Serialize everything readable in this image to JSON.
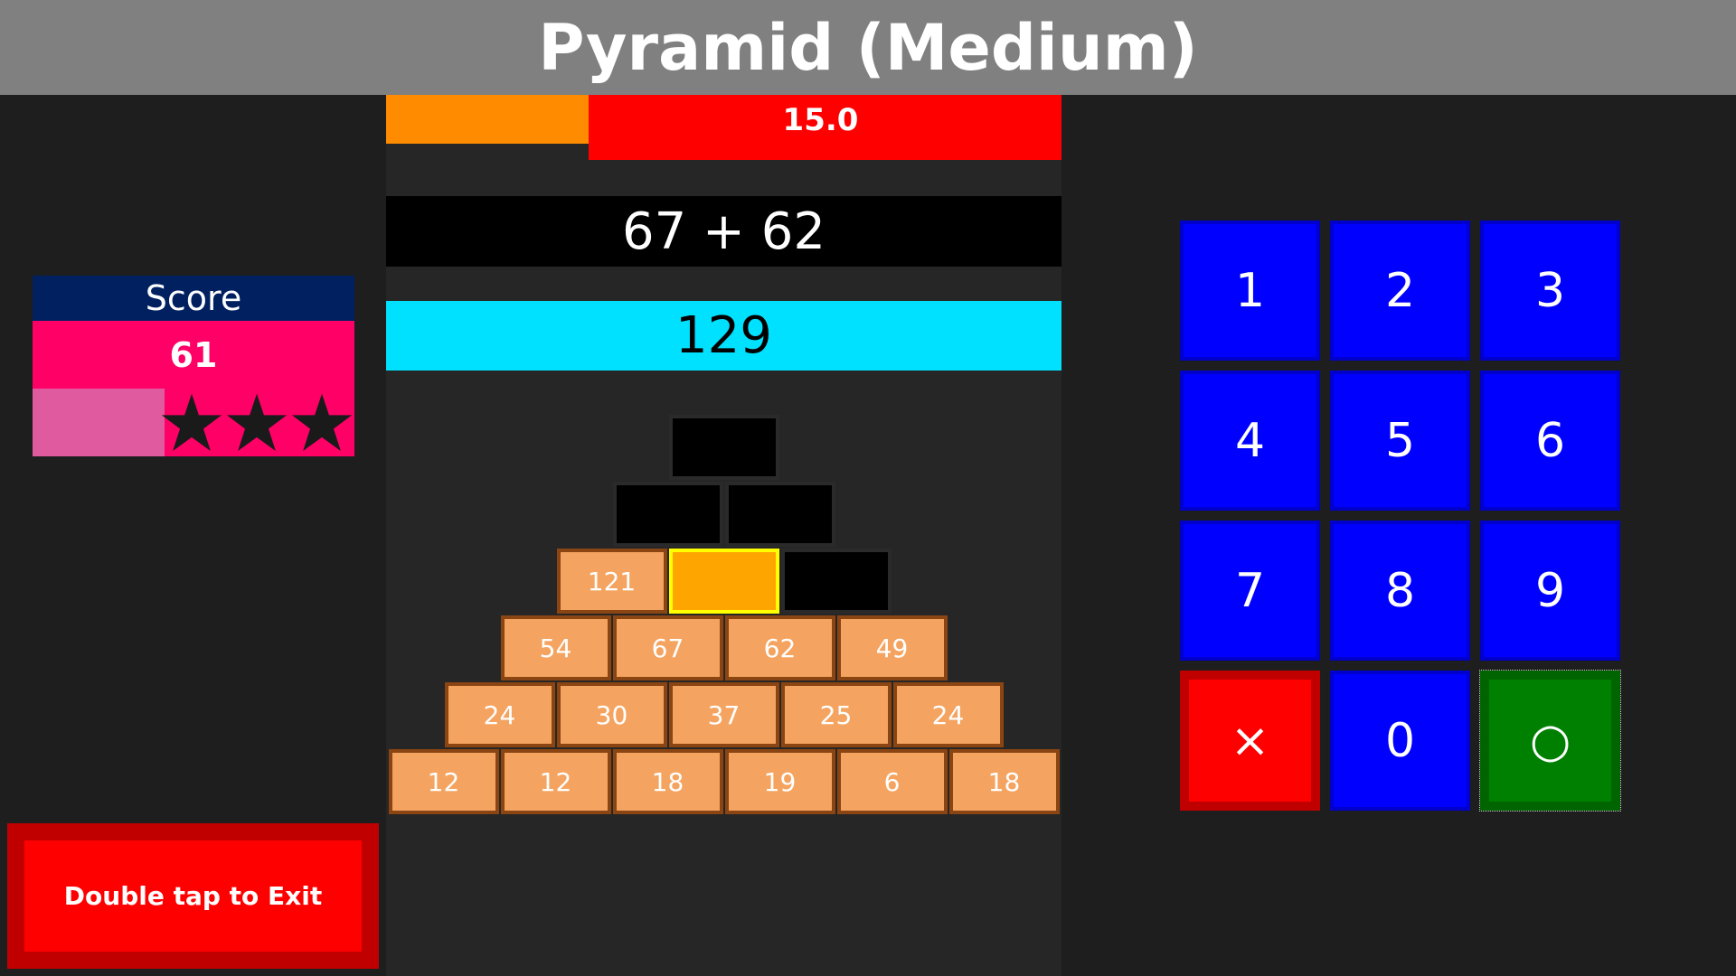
{
  "title": "Pyramid (Medium)",
  "timer": {
    "value": "15.0",
    "color_warning": "#ff8c00",
    "color_main": "#ff0000"
  },
  "problem": {
    "expression": "67 + 62"
  },
  "answer": {
    "value": "129",
    "color": "#00e0ff"
  },
  "score": {
    "label": "Score",
    "value": "61",
    "progress_fraction": 0.41,
    "stars_icon": "star-icon",
    "header_color": "#002060",
    "panel_color": "#ff0066",
    "progress_color": "#e05a9f"
  },
  "exit": {
    "label": "Double tap to Exit"
  },
  "pyramid": {
    "rows": [
      [
        {
          "value": "",
          "state": "empty"
        }
      ],
      [
        {
          "value": "",
          "state": "empty"
        },
        {
          "value": "",
          "state": "empty"
        }
      ],
      [
        {
          "value": "121",
          "state": "filled"
        },
        {
          "value": "",
          "state": "selected"
        },
        {
          "value": "",
          "state": "empty"
        }
      ],
      [
        {
          "value": "54",
          "state": "filled"
        },
        {
          "value": "67",
          "state": "filled"
        },
        {
          "value": "62",
          "state": "filled"
        },
        {
          "value": "49",
          "state": "filled"
        }
      ],
      [
        {
          "value": "24",
          "state": "filled"
        },
        {
          "value": "30",
          "state": "filled"
        },
        {
          "value": "37",
          "state": "filled"
        },
        {
          "value": "25",
          "state": "filled"
        },
        {
          "value": "24",
          "state": "filled"
        }
      ],
      [
        {
          "value": "12",
          "state": "filled"
        },
        {
          "value": "12",
          "state": "filled"
        },
        {
          "value": "18",
          "state": "filled"
        },
        {
          "value": "19",
          "state": "filled"
        },
        {
          "value": "6",
          "state": "filled"
        },
        {
          "value": "18",
          "state": "filled"
        }
      ]
    ],
    "colors": {
      "filled": "#f4a460",
      "filled_border": "#8b4513",
      "empty": "#000000",
      "selected": "#ffa500",
      "selected_border": "#ffff00"
    }
  },
  "keypad": {
    "keys": [
      {
        "label": "1",
        "kind": "digit"
      },
      {
        "label": "2",
        "kind": "digit"
      },
      {
        "label": "3",
        "kind": "digit"
      },
      {
        "label": "4",
        "kind": "digit"
      },
      {
        "label": "5",
        "kind": "digit"
      },
      {
        "label": "6",
        "kind": "digit"
      },
      {
        "label": "7",
        "kind": "digit"
      },
      {
        "label": "8",
        "kind": "digit"
      },
      {
        "label": "9",
        "kind": "digit"
      },
      {
        "label": "×",
        "kind": "clear"
      },
      {
        "label": "0",
        "kind": "digit"
      },
      {
        "label": "○",
        "kind": "ok"
      }
    ],
    "colors": {
      "digit": "#0000ff",
      "clear": "#ff0000",
      "ok": "#008000"
    }
  }
}
